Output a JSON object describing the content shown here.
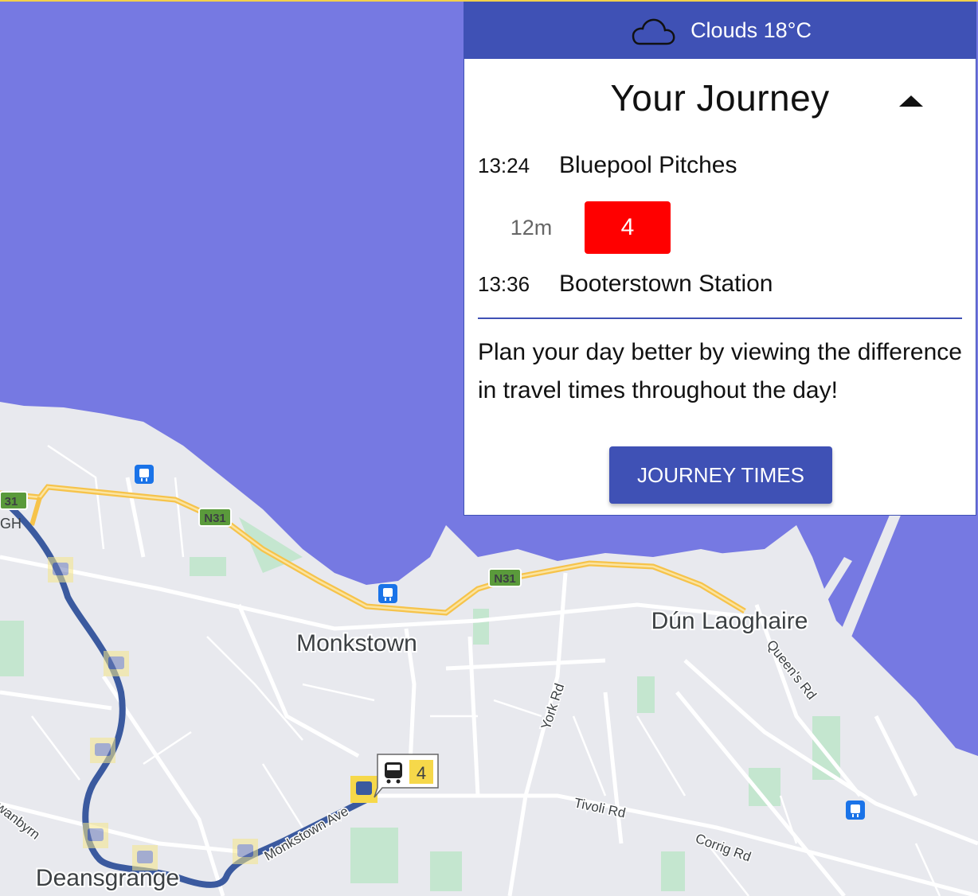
{
  "weather": {
    "icon": "cloud-icon",
    "label": "Clouds 18°C"
  },
  "journey": {
    "title": "Your Journey",
    "toggle_icon": "caret-up-icon",
    "origin": {
      "time": "13:24",
      "name": "Bluepool Pitches"
    },
    "leg": {
      "duration": "12m",
      "route": "4",
      "route_color": "#ff0000"
    },
    "destination": {
      "time": "13:36",
      "name": "Booterstown Station"
    },
    "info_text": "Plan your day better by viewing the difference in travel times throughout the day!",
    "button_label": "JOURNEY TIMES"
  },
  "map": {
    "places": [
      "Monkstown",
      "Dún Laoghaire",
      "Deansgrange"
    ],
    "roads": [
      "York Rd",
      "Tivoli Rd",
      "Corrig Rd",
      "Queen's Rd",
      "Monkstown Ave",
      "wanbyrn"
    ],
    "road_shields": [
      "N31",
      "N31",
      "N31",
      "31"
    ],
    "edge_label": "GH",
    "bus_marker": {
      "icon": "bus-icon",
      "route": "4"
    },
    "colors": {
      "sea": "#7679e2",
      "land": "#e8e9ee",
      "route_line": "#3b5a9f",
      "highway": "#f6c34a",
      "park": "#c4e6cf"
    }
  }
}
